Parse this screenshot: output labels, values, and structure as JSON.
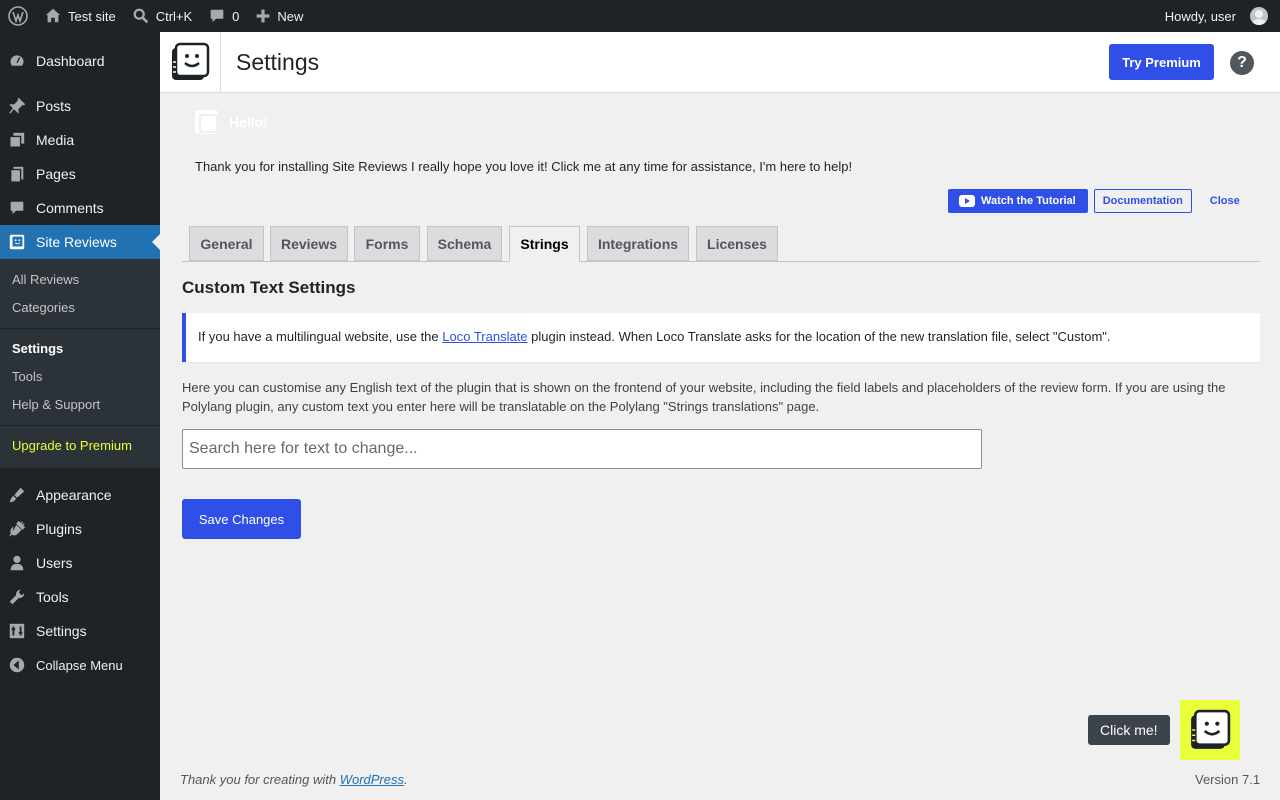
{
  "adminbar": {
    "site_name": "Test site",
    "search_shortcut": "Ctrl+K",
    "comments_count": "0",
    "new_label": "New",
    "howdy": "Howdy, user"
  },
  "sidebar": {
    "items": [
      {
        "label": "Dashboard",
        "icon": "dashboard-icon"
      },
      {
        "label": "Posts",
        "icon": "pin-icon"
      },
      {
        "label": "Media",
        "icon": "media-icon"
      },
      {
        "label": "Pages",
        "icon": "pages-icon"
      },
      {
        "label": "Comments",
        "icon": "comment-icon"
      },
      {
        "label": "Site Reviews",
        "icon": "site-reviews-icon"
      }
    ],
    "submenu": [
      "All Reviews",
      "Categories",
      "Settings",
      "Tools",
      "Help & Support",
      "Upgrade to Premium"
    ],
    "lower_items": [
      {
        "label": "Appearance",
        "icon": "brush-icon"
      },
      {
        "label": "Plugins",
        "icon": "plugin-icon"
      },
      {
        "label": "Users",
        "icon": "user-icon"
      },
      {
        "label": "Tools",
        "icon": "wrench-icon"
      },
      {
        "label": "Settings",
        "icon": "settings-icon"
      }
    ],
    "collapse": "Collapse Menu"
  },
  "header": {
    "title": "Settings",
    "premium_button": "Try Premium",
    "help": "?"
  },
  "notice": {
    "hello": "Hello!",
    "welcome": "Thank you for installing Site Reviews I really hope you love it! Click me at any time for assistance, I'm here to help!",
    "tutorial": "Watch the Tutorial",
    "documentation": "Documentation",
    "close": "Close"
  },
  "tabs": [
    "General",
    "Reviews",
    "Forms",
    "Schema",
    "Strings",
    "Integrations",
    "Licenses"
  ],
  "active_tab": "Strings",
  "main": {
    "section_title": "Custom Text Settings",
    "info_before": "If you have a multilingual website, use the ",
    "info_link": "Loco Translate",
    "info_after": " plugin instead. When Loco Translate asks for the location of the new translation file, select \"Custom\".",
    "description": "Here you can customise any English text of the plugin that is shown on the frontend of your website, including the field labels and placeholders of the review form. If you are using the Polylang plugin, any custom text you enter here will be translatable on the Polylang \"Strings translations\" page.",
    "search_placeholder": "Search here for text to change...",
    "save_button": "Save Changes"
  },
  "assistant": {
    "click_me": "Click me!"
  },
  "footer": {
    "thanks_before": "Thank you for creating with ",
    "thanks_link": "WordPress",
    "thanks_after": ".",
    "version": "Version 7.1"
  },
  "colors": {
    "accent": "#2f4fe6",
    "wp_blue": "#2271b1",
    "sidebar_bg": "#1d2327",
    "highlight": "#e8ff3a"
  }
}
